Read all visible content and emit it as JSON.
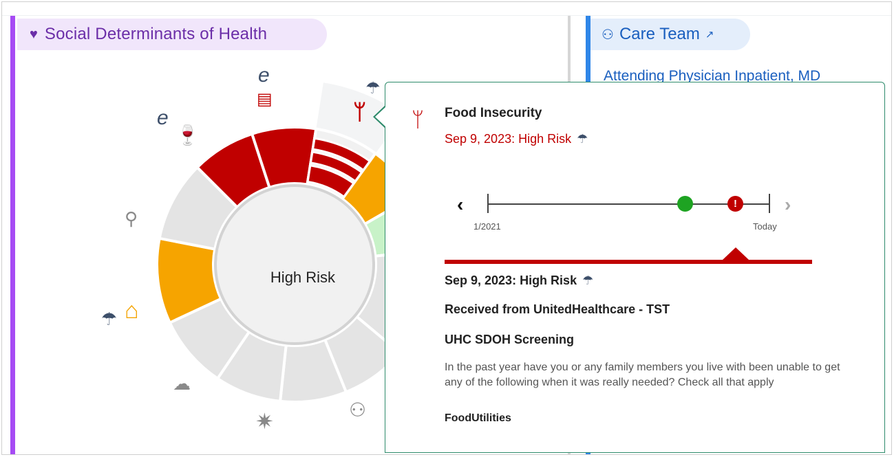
{
  "sdoh_panel": {
    "title": "Social Determinants of Health",
    "heart_icon": "heart-icon",
    "center_label": "High Risk",
    "accent_color": "#a64bf4",
    "domains": [
      {
        "name": "financial",
        "icon": "money-icon",
        "status": "high-risk",
        "color": "#c00000"
      },
      {
        "name": "food",
        "icon": "utensils-icon",
        "status": "high-risk",
        "color": "#c00000"
      },
      {
        "name": "alcohol",
        "icon": "wine-bottle-icon",
        "status": "high-risk",
        "color": "#c00000"
      },
      {
        "name": "tobacco",
        "icon": "cigarette-icon",
        "status": "not-assessed",
        "color": "#e4e4e4"
      },
      {
        "name": "housing",
        "icon": "house-icon",
        "status": "moderate-risk",
        "color": "#f6a400"
      },
      {
        "name": "weather",
        "icon": "cloud-rain-icon",
        "status": "not-assessed",
        "color": "#e4e4e4"
      },
      {
        "name": "stress",
        "icon": "stress-icon",
        "status": "not-assessed",
        "color": "#e4e4e4"
      },
      {
        "name": "social",
        "icon": "people-icon",
        "status": "not-assessed",
        "color": "#e4e4e4"
      }
    ]
  },
  "care_panel": {
    "title": "Care Team",
    "link": "Attending Physician Inpatient, MD",
    "accent_color": "#2f86e8"
  },
  "popover": {
    "title": "Food Insecurity",
    "status": "Sep 9, 2023: High Risk",
    "timeline": {
      "start": "1/2021",
      "end": "Today"
    },
    "detail": {
      "date_status": "Sep 9, 2023: High Risk",
      "source": "Received from UnitedHealthcare - TST",
      "screening": "UHC SDOH Screening",
      "question": "In the past year have you or any family members you live with been unable to get any of the following when it was really needed? Check all that apply",
      "answer": "FoodUtilities"
    },
    "risk_color": "#c00000",
    "ok_color": "#1ea322"
  },
  "icons": {
    "euro": "e",
    "umbrella": "☂"
  }
}
